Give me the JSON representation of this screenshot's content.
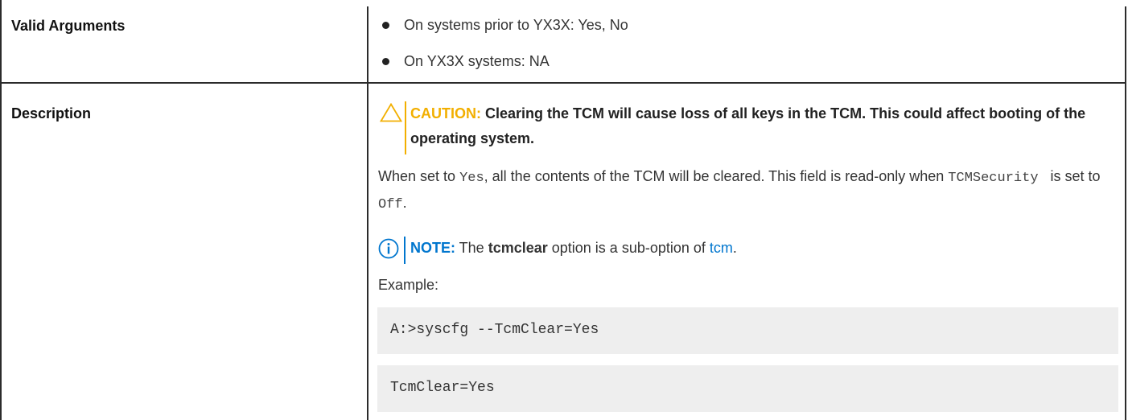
{
  "rows": {
    "valid_arguments": {
      "label": "Valid Arguments",
      "items": [
        "On systems prior to YX3X: Yes, No",
        "On YX3X systems: NA"
      ]
    },
    "description": {
      "label": "Description",
      "caution": {
        "label": "CAUTION:",
        "text": "Clearing the TCM will cause loss of all keys in the TCM. This could affect booting of the operating system."
      },
      "para": {
        "part1": "When set to ",
        "code1": "Yes",
        "part2": ", all the contents of the TCM will be cleared. This field is read-only when ",
        "code2": "TCMSecurity",
        "part3": " is set to ",
        "code3": "Off",
        "part4": "."
      },
      "note": {
        "label": "NOTE:",
        "before": " The ",
        "bold": "tcmclear",
        "middle": " option is a sub-option of ",
        "link": "tcm",
        "after": "."
      },
      "example_label": "Example:",
      "code_lines": [
        "A:>syscfg --TcmClear=Yes",
        "TcmClear=Yes"
      ]
    }
  },
  "colors": {
    "caution": "#f2af00",
    "note": "#0076ce",
    "code_bg": "#eeeeee"
  },
  "icons": {
    "caution": "caution-triangle-icon",
    "note": "info-circle-icon"
  }
}
